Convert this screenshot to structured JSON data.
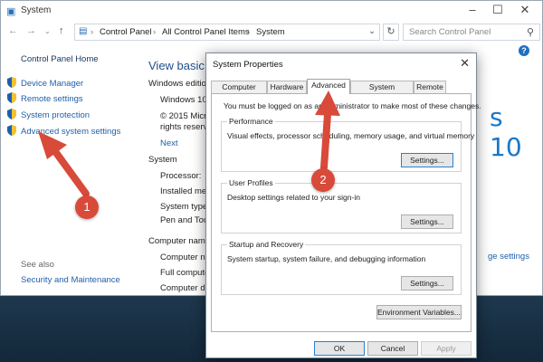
{
  "window": {
    "title": "System",
    "address_crumbs": [
      "Control Panel",
      "All Control Panel Items",
      "System"
    ],
    "search_placeholder": "Search Control Panel"
  },
  "sidebar": {
    "heading": "Control Panel Home",
    "items": [
      {
        "label": "Device Manager",
        "icon": "shield-icon"
      },
      {
        "label": "Remote settings",
        "icon": "shield-icon"
      },
      {
        "label": "System protection",
        "icon": "shield-icon"
      },
      {
        "label": "Advanced system settings",
        "icon": "shield-icon"
      }
    ],
    "see_also": "See also",
    "see_also_links": [
      "Security and Maintenance"
    ]
  },
  "main": {
    "title": "View basic in",
    "windows_edition_label": "Windows editio",
    "edition_name": "Windows 10",
    "copyright": "© 2015 Microso",
    "rights": "rights reserve",
    "next_link": "Next",
    "system_label": "System",
    "processor": "Processor:",
    "installed_memory": "Installed mem",
    "system_type": "System type:",
    "pen_touch": "Pen and Tou",
    "computer_name_label": "Computer name",
    "computer_name": "Computer na",
    "full_computer": "Full compute",
    "computer_desc": "Computer de",
    "windows_logo_text": "s 10",
    "change_settings": "ge settings"
  },
  "dialog": {
    "title": "System Properties",
    "tabs": [
      "Computer Name",
      "Hardware",
      "Advanced",
      "System Protection",
      "Remote"
    ],
    "active_tab": "Advanced",
    "admin_notice": "You must be logged on as an Administrator to make most of these changes.",
    "groups": [
      {
        "title": "Performance",
        "description": "Visual effects, processor scheduling, memory usage, and virtual memory",
        "button": "Settings..."
      },
      {
        "title": "User Profiles",
        "description": "Desktop settings related to your sign-in",
        "button": "Settings..."
      },
      {
        "title": "Startup and Recovery",
        "description": "System startup, system failure, and debugging information",
        "button": "Settings..."
      }
    ],
    "env_button": "Environment Variables...",
    "ok": "OK",
    "cancel": "Cancel",
    "apply": "Apply"
  },
  "annotations": {
    "marker1": "1",
    "marker2": "2"
  },
  "colors": {
    "marker": "#d84a3a",
    "link": "#1f5faa",
    "accent": "#1a78c7"
  }
}
